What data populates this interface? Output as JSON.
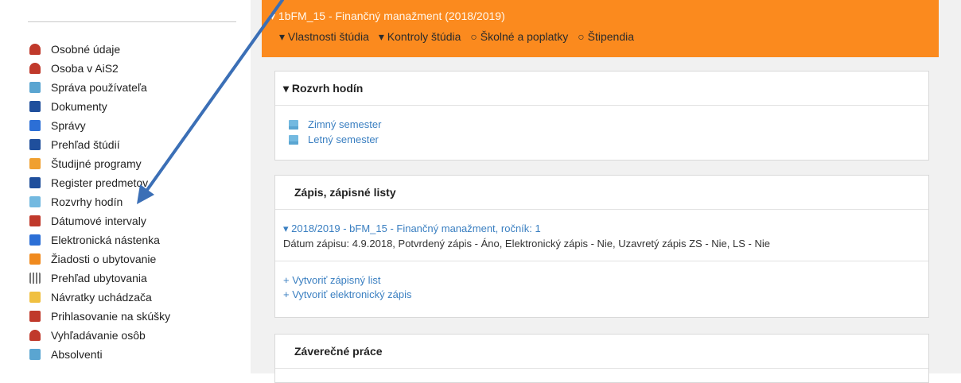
{
  "sidebar": {
    "items": [
      {
        "label": "Osobné údaje",
        "icon": "person-icon",
        "color": "#c0392b"
      },
      {
        "label": "Osoba v AiS2",
        "icon": "person-icon",
        "color": "#c0392b"
      },
      {
        "label": "Správa používateľa",
        "icon": "user-tree-icon",
        "color": "#5aa5d1"
      },
      {
        "label": "Dokumenty",
        "icon": "document-icon",
        "color": "#1f4f9c"
      },
      {
        "label": "Správy",
        "icon": "message-icon",
        "color": "#2c6fd6"
      },
      {
        "label": "Prehľad štúdií",
        "icon": "study-overview-icon",
        "color": "#1f4f9c"
      },
      {
        "label": "Študijné programy",
        "icon": "list-icon",
        "color": "#f0a030"
      },
      {
        "label": "Register predmetov",
        "icon": "briefcase-icon",
        "color": "#1f4f9c"
      },
      {
        "label": "Rozvrhy hodín",
        "icon": "calendar-icon",
        "color": "#73b9e0"
      },
      {
        "label": "Dátumové intervaly",
        "icon": "calendar-icon",
        "color": "#c0392b"
      },
      {
        "label": "Elektronická nástenka",
        "icon": "board-icon",
        "color": "#2c6fd6"
      },
      {
        "label": "Žiadosti o ubytovanie",
        "icon": "accommodation-icon",
        "color": "#f08a1e"
      },
      {
        "label": "Prehľad ubytovania",
        "icon": "grid-icon",
        "color": "#777777"
      },
      {
        "label": "Návratky uchádzača",
        "icon": "envelope-icon",
        "color": "#f0c040"
      },
      {
        "label": "Prihlasovanie na skúšky",
        "icon": "exam-icon",
        "color": "#c0392b"
      },
      {
        "label": "Vyhľadávanie osôb",
        "icon": "person-search-icon",
        "color": "#c0392b"
      },
      {
        "label": "Absolventi",
        "icon": "graduates-icon",
        "color": "#5aa5d1"
      }
    ]
  },
  "topbar": {
    "title": "▾ 1bFM_15 - Finančný manažment (2018/2019)",
    "links": [
      "▾ Vlastnosti štúdia",
      "▾ Kontroly štúdia",
      "○ Školné a poplatky",
      "○ Štipendia"
    ]
  },
  "rozvrh": {
    "header": "▾ Rozvrh hodín",
    "items": [
      "Zimný semester",
      "Letný semester"
    ]
  },
  "zapis": {
    "header": "Zápis, zápisné listy",
    "entry_link": "▾ 2018/2019 - bFM_15 - Finančný manažment, ročník: 1",
    "entry_detail": "Dátum zápisu: 4.9.2018, Potvrdený zápis - Áno, Elektronický zápis - Nie, Uzavretý zápis ZS - Nie, LS - Nie",
    "actions": [
      "+ Vytvoriť zápisný list",
      "+ Vytvoriť elektronický zápis"
    ]
  },
  "zaverecne": {
    "header": "Záverečné práce"
  },
  "colors": {
    "accent": "#fb8a1e",
    "link": "#3a7fc1",
    "annotation_arrow": "#3b6fb6"
  }
}
